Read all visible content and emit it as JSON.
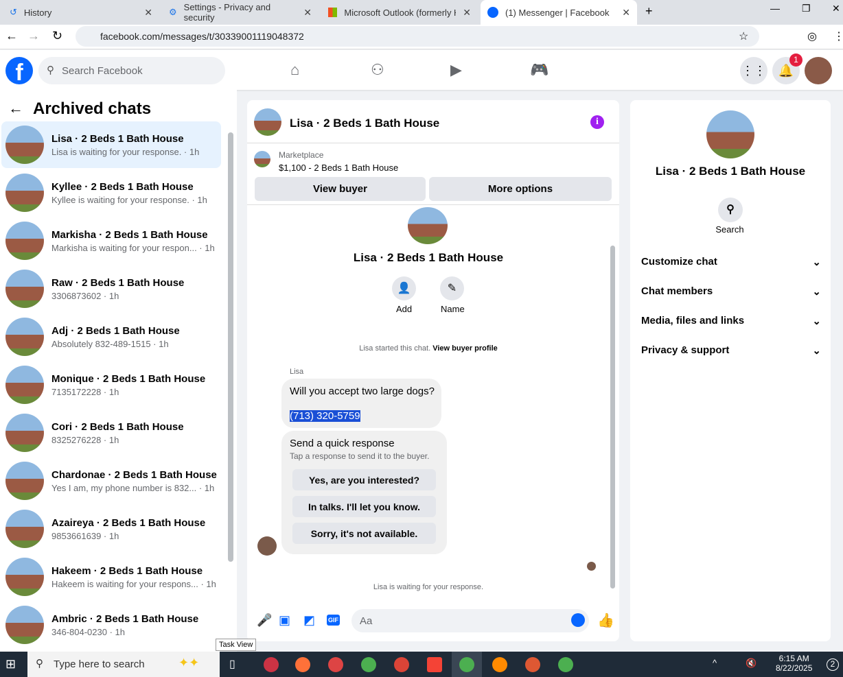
{
  "browser": {
    "tabs": [
      {
        "label": "History",
        "icon": "history-icon"
      },
      {
        "label": "Settings - Privacy and security",
        "icon": "gear-icon"
      },
      {
        "label": "Microsoft Outlook (formerly Ho",
        "icon": "microsoft-icon"
      },
      {
        "label": "(1) Messenger | Facebook",
        "icon": "facebook-icon"
      }
    ],
    "url": "facebook.com/messages/t/30339001119048372"
  },
  "fb": {
    "search_placeholder": "Search Facebook",
    "notification_count": "1"
  },
  "left": {
    "title": "Archived chats",
    "chats": [
      {
        "name": "Lisa · 2 Beds 1 Bath House",
        "sub": "Lisa is waiting for your response. · 1h"
      },
      {
        "name": "Kyllee · 2 Beds 1 Bath House",
        "sub": "Kyllee is waiting for your response. · 1h"
      },
      {
        "name": "Markisha · 2 Beds 1 Bath House",
        "sub": "Markisha is waiting for your respon... · 1h"
      },
      {
        "name": "Raw · 2 Beds 1 Bath House",
        "sub": "3306873602 · 1h"
      },
      {
        "name": "Adj · 2 Beds 1 Bath House",
        "sub": "Absolutely 832-489-1515 · 1h"
      },
      {
        "name": "Monique · 2 Beds 1 Bath House",
        "sub": "7135172228 · 1h"
      },
      {
        "name": "Cori · 2 Beds 1 Bath House",
        "sub": "8325276228 · 1h"
      },
      {
        "name": "Chardonae · 2 Beds 1 Bath House",
        "sub": "Yes I am, my phone number is 832... · 1h"
      },
      {
        "name": "Azaireya · 2 Beds 1 Bath House",
        "sub": "9853661639 · 1h"
      },
      {
        "name": "Hakeem · 2 Beds 1 Bath House",
        "sub": "Hakeem is waiting for your respons... · 1h"
      },
      {
        "name": "Ambric · 2 Beds 1 Bath House",
        "sub": "346-804-0230 · 1h"
      }
    ]
  },
  "chat": {
    "title": "Lisa · 2 Beds 1 Bath House",
    "marketplace_label": "Marketplace",
    "listing": "$1,100 - 2 Beds 1 Bath House",
    "view_buyer": "View buyer",
    "more_options": "More options",
    "profile_name": "Lisa · 2 Beds 1 Bath House",
    "add_label": "Add",
    "name_label": "Name",
    "started_text": "Lisa started this chat.",
    "view_profile": "View buyer profile",
    "sender": "Lisa",
    "message": "Will you accept two large dogs?",
    "phone": "(713) 320-5759",
    "quick_title": "Send a quick response",
    "quick_sub": "Tap a response to send it to the buyer.",
    "quick_responses": [
      "Yes, are you interested?",
      "In talks. I'll let you know.",
      "Sorry, it's not available."
    ],
    "waiting": "Lisa is waiting for your response.",
    "input_placeholder": "Aa",
    "tooltip": "Task View"
  },
  "right": {
    "name": "Lisa · 2 Beds 1 Bath House",
    "search_label": "Search",
    "sections": [
      "Customize chat",
      "Chat members",
      "Media, files and links",
      "Privacy & support"
    ]
  },
  "taskbar": {
    "search_placeholder": "Type here to search",
    "time": "6:15 AM",
    "date": "8/22/2025",
    "notif": "2"
  },
  "colors": {
    "accent": "#0866ff",
    "selected": "#e6f2fe",
    "info": "#a020f0"
  }
}
